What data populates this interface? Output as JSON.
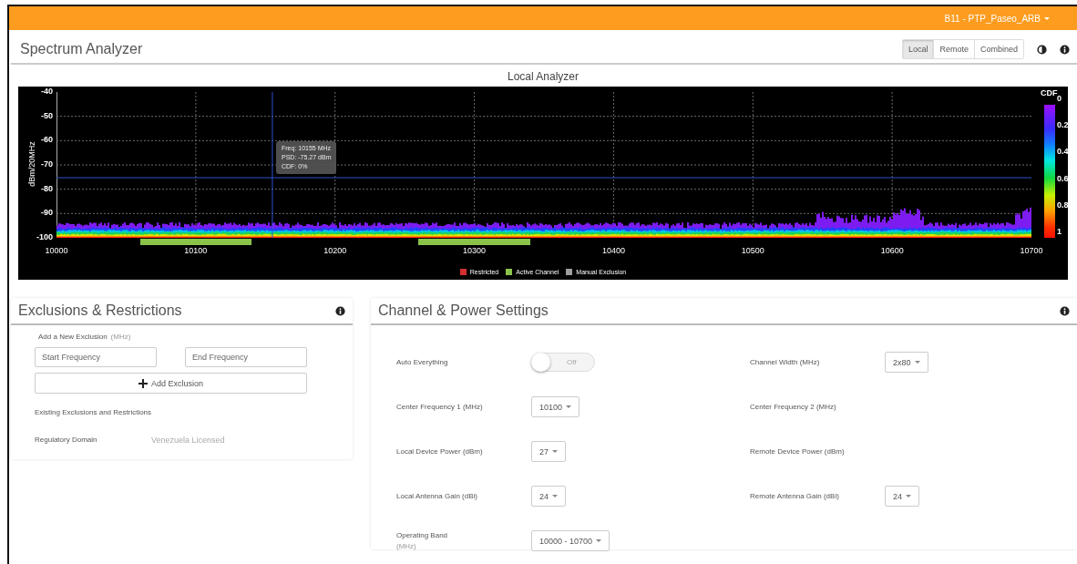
{
  "top_bar": {
    "device_menu": "B11 - PTP_Paseo_ARB"
  },
  "header": {
    "title": "Spectrum Analyzer",
    "view_tabs": [
      {
        "label": "Local",
        "selected": true
      },
      {
        "label": "Remote",
        "selected": false
      },
      {
        "label": "Combined",
        "selected": false
      }
    ]
  },
  "analyzer": {
    "title": "Local  Analyzer",
    "ylabel": "dBm/20MHz",
    "yticks": [
      "-40",
      "-50",
      "-60",
      "-70",
      "-80",
      "-90",
      "-100"
    ],
    "xticks": [
      "10000",
      "10100",
      "10200",
      "10300",
      "10400",
      "10500",
      "10600",
      "10700"
    ],
    "cursor_tooltip": [
      "Freq: 10155 MHz",
      "PSD: -75.27 dBm",
      "CDF: 0%"
    ],
    "colorbar": {
      "title": "CDF",
      "ticks": [
        "0",
        "0.2",
        "0.4",
        "0.6",
        "0.8",
        "1"
      ]
    },
    "legend": [
      {
        "label": "Restricted",
        "color": "#d32f2f"
      },
      {
        "label": "Active Channel",
        "color": "#8bc34a"
      },
      {
        "label": "Manual Exclusion",
        "color": "#9e9e9e"
      }
    ]
  },
  "exclusions": {
    "title": "Exclusions & Restrictions",
    "add_label": "Add a New Exclusion",
    "add_unit": "(MHz)",
    "start_field": {
      "placeholder": "Start Frequency"
    },
    "end_field": {
      "placeholder": "End Frequency"
    },
    "add_button": "Add Exclusion",
    "existing_heading": "Existing Exclusions and Restrictions",
    "regulatory_label": "Regulatory Domain",
    "regulatory_value": "Venezuela Licensed"
  },
  "channel_power": {
    "title": "Channel & Power Settings",
    "settings": [
      {
        "kind": "toggle",
        "label": "Auto Everything",
        "on": false,
        "state_text": "Off"
      },
      {
        "kind": "select",
        "label": "Channel Width (MHz)",
        "value": "2x80"
      },
      {
        "kind": "select",
        "label": "Center Frequency 1 (MHz)",
        "value": "10100"
      },
      {
        "kind": "text",
        "label": "Center Frequency 2 (MHz)"
      },
      {
        "kind": "select",
        "label": "Local Device Power (dBm)",
        "value": "27"
      },
      {
        "kind": "text",
        "label": "Remote Device Power (dBm)"
      },
      {
        "kind": "select",
        "label": "Local Antenna Gain (dBi)",
        "value": "24"
      },
      {
        "kind": "select",
        "label": "Remote Antenna Gain (dBi)",
        "value": "24"
      },
      {
        "kind": "select",
        "label": "Operating Band",
        "sublabel": "(MHz)",
        "value": "10000 - 10700"
      }
    ]
  }
}
